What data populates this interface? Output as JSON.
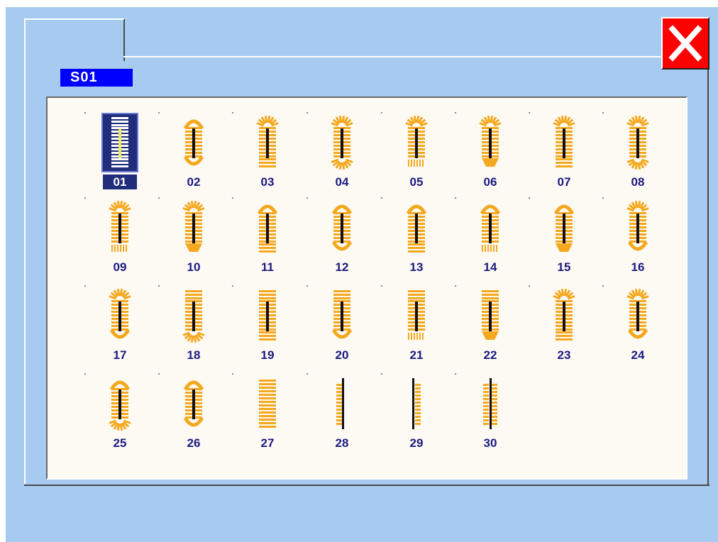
{
  "window": {
    "title": "S01",
    "close_icon": "close-x-icon"
  },
  "colors": {
    "background": "#a6caf0",
    "title_bg": "#0000ff",
    "close_bg": "#ff0000",
    "stitch": "#f4a81e",
    "selected_bg": "#1f2d7a",
    "number_text": "#1a1a80"
  },
  "patterns": {
    "selected": "01",
    "items": [
      {
        "id": "01",
        "shape": "bartack-both"
      },
      {
        "id": "02",
        "shape": "round-both"
      },
      {
        "id": "03",
        "shape": "radial-top-square-bottom"
      },
      {
        "id": "04",
        "shape": "radial-both"
      },
      {
        "id": "05",
        "shape": "radial-top-comb-bottom"
      },
      {
        "id": "06",
        "shape": "radial-top-tapered"
      },
      {
        "id": "07",
        "shape": "radial-wide-top-square"
      },
      {
        "id": "08",
        "shape": "radial-wide-both"
      },
      {
        "id": "09",
        "shape": "radial-wide-top-comb"
      },
      {
        "id": "10",
        "shape": "radial-wide-top-tapered"
      },
      {
        "id": "11",
        "shape": "round-top-square"
      },
      {
        "id": "12",
        "shape": "round-both-narrow"
      },
      {
        "id": "13",
        "shape": "round-top-square-wide"
      },
      {
        "id": "14",
        "shape": "round-top-comb"
      },
      {
        "id": "15",
        "shape": "round-top-tapered"
      },
      {
        "id": "16",
        "shape": "radial-wide-both-round"
      },
      {
        "id": "17",
        "shape": "radial-top-round-bottom"
      },
      {
        "id": "18",
        "shape": "square-top-radial-bottom"
      },
      {
        "id": "19",
        "shape": "square-both"
      },
      {
        "id": "20",
        "shape": "square-top-round-bottom"
      },
      {
        "id": "21",
        "shape": "square-top-comb-bottom"
      },
      {
        "id": "22",
        "shape": "square-top-tapered"
      },
      {
        "id": "23",
        "shape": "radial-small-top-square"
      },
      {
        "id": "24",
        "shape": "radial-small-top-round"
      },
      {
        "id": "25",
        "shape": "round-top-radial-bottom"
      },
      {
        "id": "26",
        "shape": "round-both-thin"
      },
      {
        "id": "27",
        "shape": "plain-bartack"
      },
      {
        "id": "28",
        "shape": "straight-left"
      },
      {
        "id": "29",
        "shape": "straight-right"
      },
      {
        "id": "30",
        "shape": "straight-both"
      }
    ]
  }
}
